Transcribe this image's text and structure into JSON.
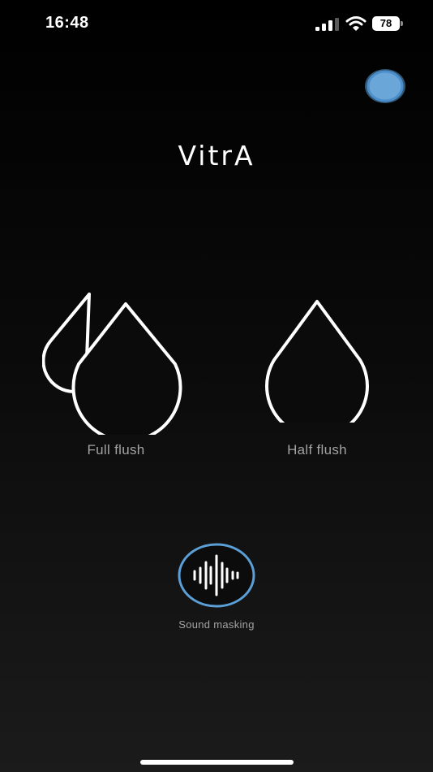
{
  "status_bar": {
    "time": "16:48",
    "battery_level": "78",
    "icons": [
      "signal-icon",
      "wifi-icon",
      "battery-icon"
    ]
  },
  "header": {
    "profile_icon": "profile-circle-icon",
    "accent_color": "#5b9fd6"
  },
  "brand": {
    "logo_text": "VitrA"
  },
  "flush_options": {
    "full": {
      "label": "Full flush",
      "icon": "double-water-drop-icon"
    },
    "half": {
      "label": "Half flush",
      "icon": "water-drop-icon"
    }
  },
  "sound_masking": {
    "label": "Sound masking",
    "icon": "sound-wave-icon",
    "ring_color": "#5b9fd6"
  },
  "colors": {
    "background_top": "#000000",
    "background_bottom": "#1b1b1b",
    "label_gray": "#a3a3a3"
  }
}
